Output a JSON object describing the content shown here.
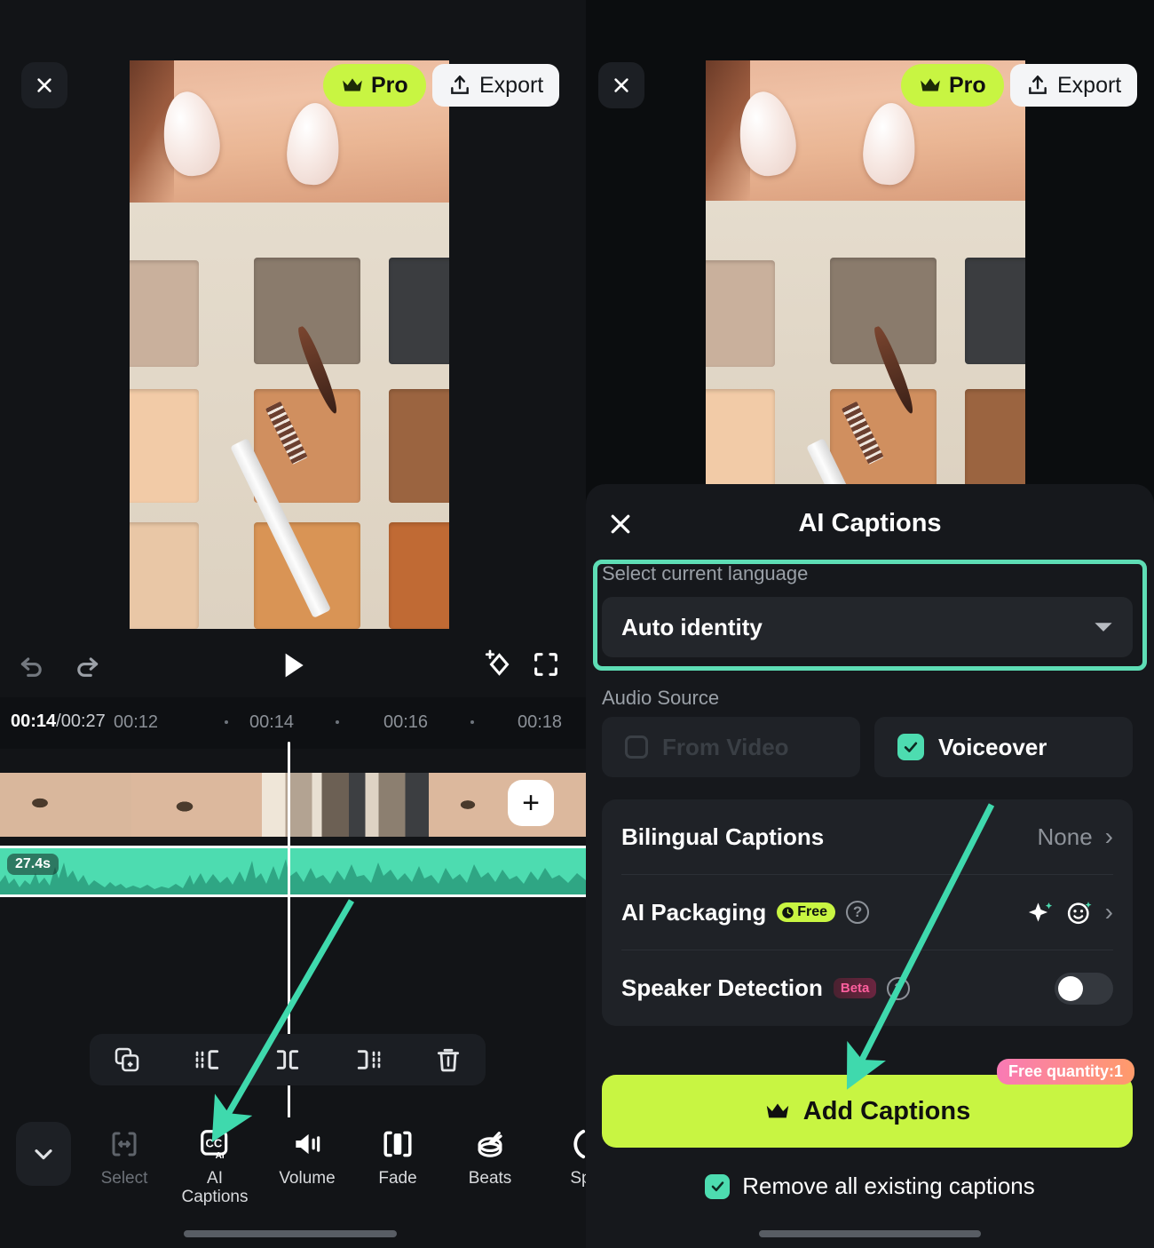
{
  "app": {
    "accent_lime": "#c8f542",
    "accent_teal": "#4ddcb0",
    "bg_dark": "#121417"
  },
  "left_panel": {
    "close_icon": "close-icon",
    "pro_label": "Pro",
    "export_label": "Export",
    "player_controls": [
      {
        "name": "undo-button",
        "icon": "undo-icon"
      },
      {
        "name": "redo-button",
        "icon": "redo-icon"
      },
      {
        "name": "play-button",
        "icon": "play-icon"
      },
      {
        "name": "ai-effects-button",
        "icon": "sparkle-diamond-icon"
      },
      {
        "name": "fullscreen-button",
        "icon": "fullscreen-icon"
      }
    ],
    "timeline": {
      "current_time": "00:14",
      "total_time": "/00:27",
      "ticks": [
        "00:12",
        "00:14",
        "00:16",
        "00:18"
      ],
      "audio_duration_badge": "27.4s",
      "add_clip_label": "+"
    },
    "edit_toolbar": [
      {
        "name": "duplicate-button",
        "icon": "duplicate-icon"
      },
      {
        "name": "trim-left-button",
        "icon": "trim-left-icon"
      },
      {
        "name": "split-button",
        "icon": "split-icon"
      },
      {
        "name": "trim-right-button",
        "icon": "trim-right-icon"
      },
      {
        "name": "delete-button",
        "icon": "trash-icon"
      }
    ],
    "bottom_nav": {
      "collapse_icon": "chevron-down-icon",
      "items": [
        {
          "label": "Select",
          "icon": "select-range-icon",
          "dim": true
        },
        {
          "label": "AI\nCaptions",
          "label_line1": "AI",
          "label_line2": "Captions",
          "icon": "cc-ai-icon",
          "dim": false
        },
        {
          "label": "Volume",
          "icon": "volume-icon",
          "dim": false
        },
        {
          "label": "Fade",
          "icon": "fade-icon",
          "dim": false
        },
        {
          "label": "Beats",
          "icon": "beats-icon",
          "dim": false
        },
        {
          "label": "Sp",
          "icon": "speed-icon",
          "dim": false
        }
      ]
    }
  },
  "right_panel": {
    "close_icon": "close-icon",
    "pro_label": "Pro",
    "export_label": "Export",
    "sheet": {
      "title": "AI Captions",
      "close_icon": "close-icon",
      "language": {
        "label": "Select current language",
        "value": "Auto identity",
        "dropdown_icon": "caret-down-icon",
        "highlight_color": "#5eddb5"
      },
      "audio_source": {
        "label": "Audio Source",
        "options": [
          {
            "label": "From Video",
            "checked": false,
            "disabled": true
          },
          {
            "label": "Voiceover",
            "checked": true,
            "disabled": false
          }
        ]
      },
      "settings": [
        {
          "name": "Bilingual Captions",
          "value": "None",
          "badge": null,
          "help": false,
          "control": "chevron"
        },
        {
          "name": "AI Packaging",
          "value": "",
          "badge": "Free",
          "badge_type": "free",
          "help": true,
          "control": "icons-chevron"
        },
        {
          "name": "Speaker Detection",
          "value": "",
          "badge": "Beta",
          "badge_type": "beta",
          "help": true,
          "control": "toggle",
          "toggle_on": false
        }
      ],
      "cta": {
        "label": "Add Captions",
        "icon": "crown-icon",
        "free_quantity_badge": "Free quantity:1"
      },
      "remove_captions": {
        "label": "Remove all existing captions",
        "checked": true
      }
    }
  }
}
